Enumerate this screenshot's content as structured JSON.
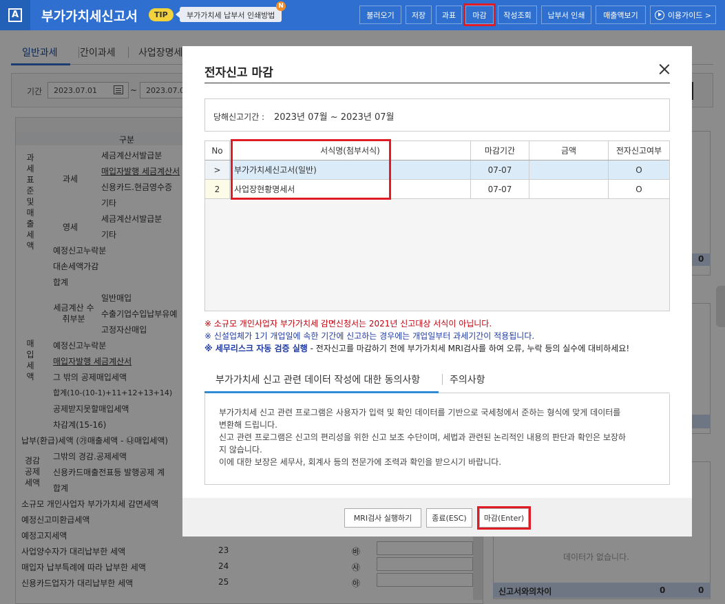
{
  "app": {
    "title": "부가가치세신고서",
    "tip_badge": "TIP",
    "tip_text": "부가가치세 납부서 인쇄방법",
    "new_dot": "N"
  },
  "toolbar": {
    "buttons": [
      "불러오기",
      "저장",
      "과표",
      "마감",
      "작성조회",
      "납부서 인쇄",
      "매출액보기",
      "이용가이드 >"
    ]
  },
  "tabs": [
    "일반과세",
    "간이과세",
    "사업장명세"
  ],
  "period": {
    "label": "기간",
    "start": "2023.07.01",
    "end": "2023.07.0",
    "tilde": "~"
  },
  "left_table": {
    "header": "구분",
    "labels": [
      "과 세 표 준 및 매 출 세 액",
      "과세",
      "세금계산서발급분",
      "매입자발행 세금계산서",
      "신용카드.현금영수증",
      "기타",
      "영세",
      "세금계산서발급분",
      "기타",
      "예정신고누락분",
      "대손세액가감",
      "합계",
      "매 입 세 액",
      "세금계산 수취부분",
      "일반매입",
      "수출기업수입납부유예",
      "고정자산매입",
      "예정신고누락분",
      "매입자발행 세금계산서",
      "그 밖의 공제매입세액",
      "합계(10-(10-1)+11+12+13+14)",
      "공제받지못할매입세액",
      "차감계(15-16)",
      "납부(환급)세액 (㉮매출세액 - ㉯매입세액)",
      "경감 공제 세액",
      "그밖의 경감.공제세액",
      "신용카드매출전표등 발행공제 계",
      "합계",
      "소규모 개인사업자 부가가치세 감면세액",
      "예정신고미환급세액",
      "예정고지세액",
      "사업양수자가 대리납부한 세액",
      "매입자 납부특례에 따라 납부한 세액",
      "신용카드업자가 대리납부한 세액"
    ],
    "row_numbers": [
      "23",
      "24",
      "25"
    ],
    "row_symbols": [
      "㉳",
      "㉴",
      "㉵"
    ]
  },
  "right_panel": {
    "zero": "0",
    "no_data": "데이터가 없습니다.",
    "diff_label": "신고서와의차이",
    "diff_values": [
      "0",
      "0"
    ]
  },
  "modal": {
    "title": "전자신고 마감",
    "period_label": "당해신고기간 :",
    "period_value": "2023년 07월 ~ 2023년 07월",
    "columns": [
      "No",
      "서식명(첨부서식)",
      "마감기간",
      "금액",
      "전자신고여부"
    ],
    "rows": [
      {
        "no": ">",
        "name": "부가가치세신고서(일반)",
        "period": "07-07",
        "amount": "",
        "efile": "O"
      },
      {
        "no": "2",
        "name": "사업장현황명세서",
        "period": "07-07",
        "amount": "",
        "efile": "O"
      }
    ],
    "notes": {
      "red": "※ 소규모 개인사업자 부가가치세 감면신청서는 2021년 신고대상 서식이 아닙니다.",
      "blue1": "※ 신설업체가 1기 개업일에 속한 기간에 신고하는 경우에는 개업일부터 과세기간이 적용됩니다.",
      "blue2_bold": "※ 세무리스크 자동 검증 실행",
      "blue2_rest": " - 전자신고를 마감하기 전에 부가가치세 MRI검사를 하여 오류, 누락 등의 실수에 대비하세요!"
    },
    "subtabs": [
      "부가가치세 신고 관련 데이터 작성에 대한 동의사항",
      "주의사항"
    ],
    "consent": [
      "부가가치세 신고 관련 프로그램은 사용자가 입력 및 확인 데이터를 기반으로 국세청에서 준하는 형식에 맞게 데이터를",
      "변환해 드립니다.",
      "신고 관련 프로그램은 신고의 편리성을 위한 신고 보조 수단이며, 세법과 관련된 논리적인 내용의 판단과 확인은 보장하",
      "지 않습니다.",
      "이에 대한 보장은 세무사, 회계사 등의 전문가에 조력과 확인을 받으시기 바랍니다."
    ],
    "buttons": {
      "mri": "MRI검사 실행하기",
      "close": "종료(ESC)",
      "finish": "마감(Enter)"
    }
  },
  "colors": {
    "brand": "#2f6fcf",
    "highlight": "#e01b24"
  }
}
